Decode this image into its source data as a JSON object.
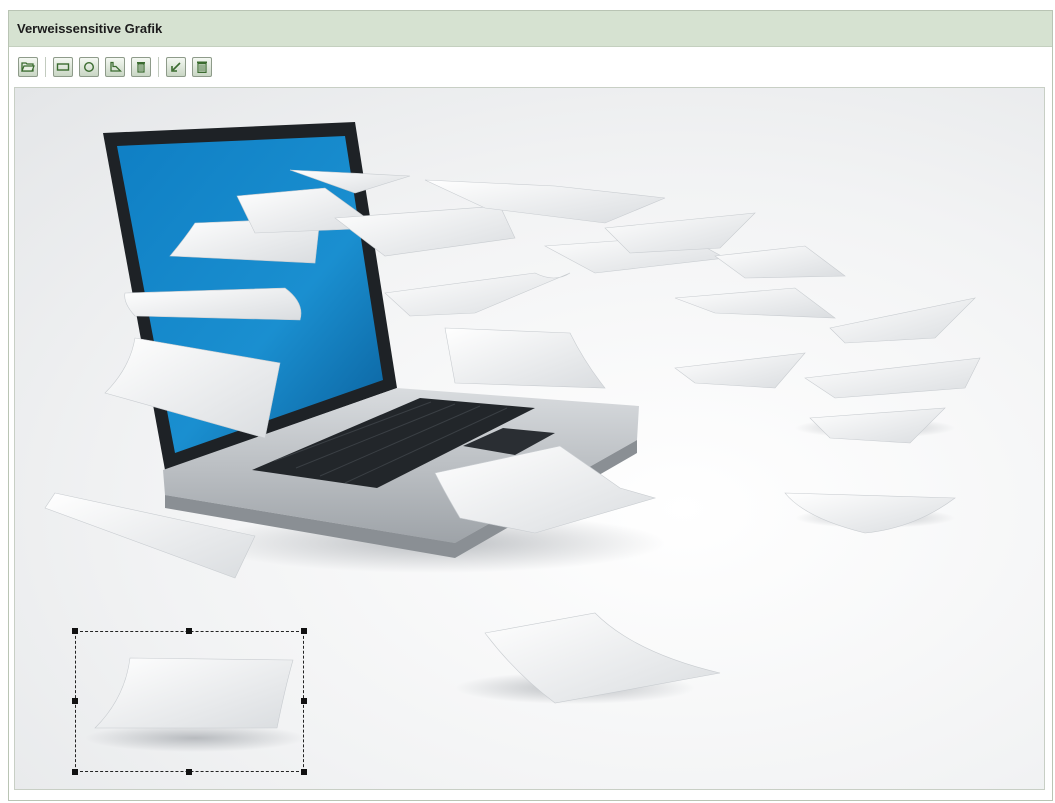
{
  "window": {
    "title": "Verweissensitive Grafik"
  },
  "toolbar": {
    "buttons": [
      {
        "name": "open-folder-button",
        "icon": "open-folder-icon"
      },
      {
        "name": "rectangle-tool-button",
        "icon": "rectangle-icon"
      },
      {
        "name": "circle-tool-button",
        "icon": "circle-icon"
      },
      {
        "name": "polygon-tool-button",
        "icon": "polygon-icon"
      },
      {
        "name": "delete-button",
        "icon": "trash-icon"
      },
      {
        "name": "edit-link-button",
        "icon": "edit-arrow-icon"
      },
      {
        "name": "delete-all-button",
        "icon": "trash-all-icon"
      }
    ]
  },
  "colors": {
    "title_bar": "#d6e2d1",
    "screen_blue": "#1a8fd0",
    "icon_green": "#3a6b2f"
  },
  "image": {
    "subject": "laptop with flying paper sheets",
    "selection": {
      "shape": "rectangle",
      "state": "selected"
    }
  }
}
